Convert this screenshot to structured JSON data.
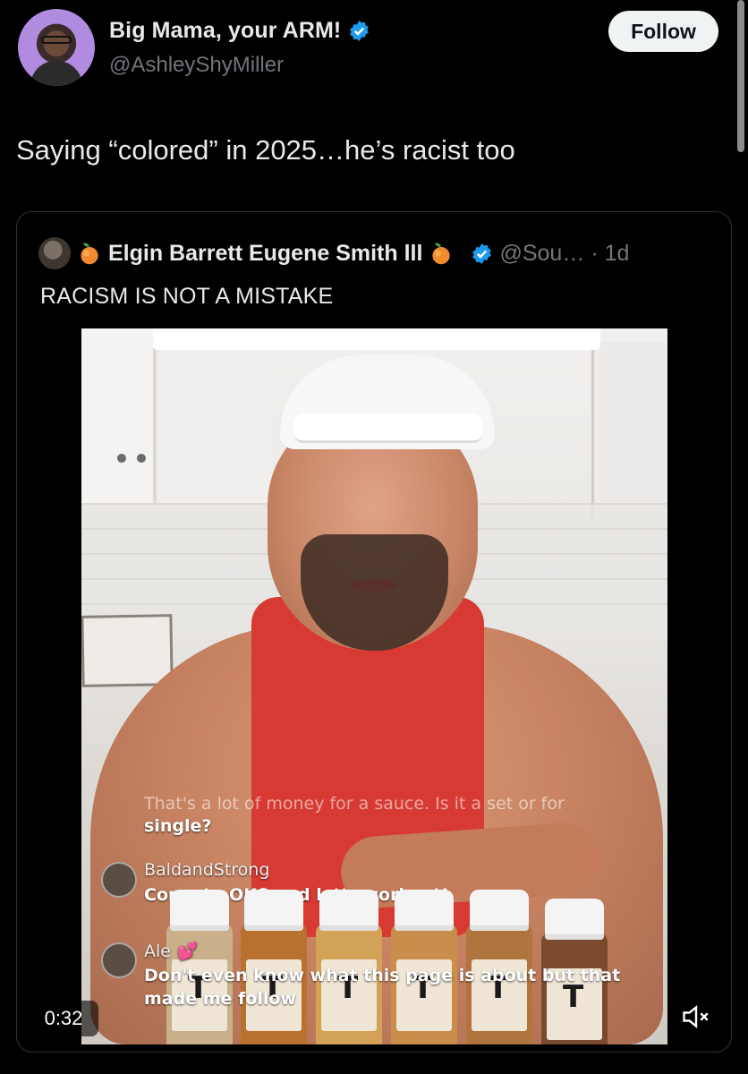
{
  "author": {
    "display_name": "Big Mama, your ARM!",
    "handle": "@AshleyShyMiller",
    "verified": true
  },
  "follow_button": {
    "label": "Follow"
  },
  "tweet": {
    "text": "Saying “colored” in 2025…he’s racist too"
  },
  "quoted": {
    "display_name": "Elgin Barrett Eugene Smith lll",
    "handle": "@Sou…",
    "time": "· 1d",
    "text": "RACISM IS NOT A MISTAKE",
    "emoji": "peach"
  },
  "video": {
    "duration": "0:32",
    "comments": [
      {
        "user": "",
        "text": "That's a lot of money for a sauce. Is it a set or for",
        "faded": true
      },
      {
        "user": "",
        "text": "single?"
      },
      {
        "user": "BaldandStrong",
        "text": "Come to OKC and let's workout!"
      },
      {
        "user": "Ale",
        "text": "Don't even know what this page is about but that"
      },
      {
        "user": "",
        "text": "made me follow"
      }
    ],
    "bottle_letter": "T",
    "mute_icon": "speaker-muted-icon"
  },
  "colors": {
    "verified_blue": "#1d9bf0",
    "background": "#000000",
    "secondary_text": "#71767b"
  }
}
